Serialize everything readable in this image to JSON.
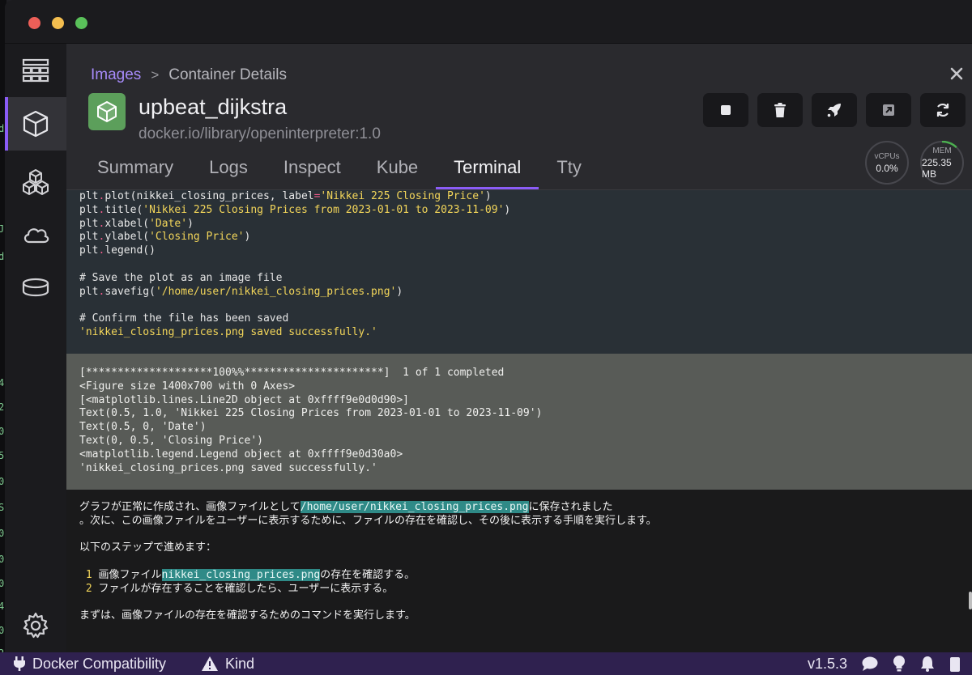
{
  "window": {
    "breadcrumb": {
      "link": "Images",
      "separator": ">",
      "current": "Container Details"
    }
  },
  "container": {
    "name": "upbeat_dijkstra",
    "image": "docker.io/library/openinterpreter:1.0",
    "stats": {
      "cpu_label": "vCPUs",
      "cpu_value": "0.0%",
      "mem_label": "MEM",
      "mem_value": "225.35 MB",
      "mem_fraction": 0.12
    }
  },
  "actions": [
    {
      "name": "stop-button",
      "icon": "stop-icon"
    },
    {
      "name": "delete-button",
      "icon": "trash-icon"
    },
    {
      "name": "deploy-button",
      "icon": "rocket-icon"
    },
    {
      "name": "open-browser-button",
      "icon": "external-link-icon"
    },
    {
      "name": "restart-button",
      "icon": "refresh-icon"
    }
  ],
  "tabs": [
    {
      "label": "Summary",
      "active": false
    },
    {
      "label": "Logs",
      "active": false
    },
    {
      "label": "Inspect",
      "active": false
    },
    {
      "label": "Kube",
      "active": false
    },
    {
      "label": "Terminal",
      "active": true
    },
    {
      "label": "Tty",
      "active": false
    }
  ],
  "terminal": {
    "code": {
      "l1_a": "plt",
      "l1_b": ".",
      "l1_c": "plot(nikkei_closing_prices, label",
      "l1_d": "=",
      "l1_e": "'Nikkei 225 Closing Price'",
      "l1_f": ")",
      "l2_a": "plt",
      "l2_b": ".",
      "l2_c": "title(",
      "l2_d": "'Nikkei 225 Closing Prices from 2023-01-01 to 2023-11-09'",
      "l2_e": ")",
      "l3_a": "plt",
      "l3_b": ".",
      "l3_c": "xlabel(",
      "l3_d": "'Date'",
      "l3_e": ")",
      "l4_a": "plt",
      "l4_b": ".",
      "l4_c": "ylabel(",
      "l4_d": "'Closing Price'",
      "l4_e": ")",
      "l5_a": "plt",
      "l5_b": ".",
      "l5_c": "legend()",
      "c1": "# Save the plot as an image file",
      "l6_a": "plt",
      "l6_b": ".",
      "l6_c": "savefig(",
      "l6_d": "'/home/user/nikkei_closing_prices.png'",
      "l6_e": ")",
      "c2": "# Confirm the file has been saved",
      "l7": "'nikkei_closing_prices.png saved successfully.'"
    },
    "output": [
      "[********************100%%**********************]  1 of 1 completed",
      "<Figure size 1400x700 with 0 Axes>",
      "[<matplotlib.lines.Line2D object at 0xffff9e0d0d90>]",
      "Text(0.5, 1.0, 'Nikkei 225 Closing Prices from 2023-01-01 to 2023-11-09')",
      "Text(0.5, 0, 'Date')",
      "Text(0, 0.5, 'Closing Price')",
      "<matplotlib.legend.Legend object at 0xffff9e0d30a0>",
      "'nikkei_closing_prices.png saved successfully.'"
    ],
    "message": {
      "p1_a": "グラフが正常に作成され、画像ファイルとして",
      "p1_hl": "/home/user/nikkei_closing_prices.png",
      "p1_b": "に保存されました",
      "p2": "。次に、この画像ファイルをユーザーに表示するために、ファイルの存在を確認し、その後に表示する手順を実行します。",
      "p3": "以下のステップで進めます：",
      "s1_num": "1",
      "s1_a": "画像ファイル",
      "s1_hl": "nikkei_closing_prices.png",
      "s1_b": "の存在を確認する。",
      "s2_num": "2",
      "s2_a": "ファイルが存在することを確認したら、ユーザーに表示する。",
      "p4": "まずは、画像ファイルの存在を確認するためのコマンドを実行します。"
    }
  },
  "statusbar": {
    "docker_compat": "Docker Compatibility",
    "kind": "Kind",
    "version": "v1.5.3"
  },
  "desk_strip": [
    "d",
    "Ju",
    "d",
    "4",
    "2",
    "0",
    "5",
    "0",
    "S",
    "0",
    "0",
    "0",
    "4",
    "0",
    "2",
    "0"
  ]
}
